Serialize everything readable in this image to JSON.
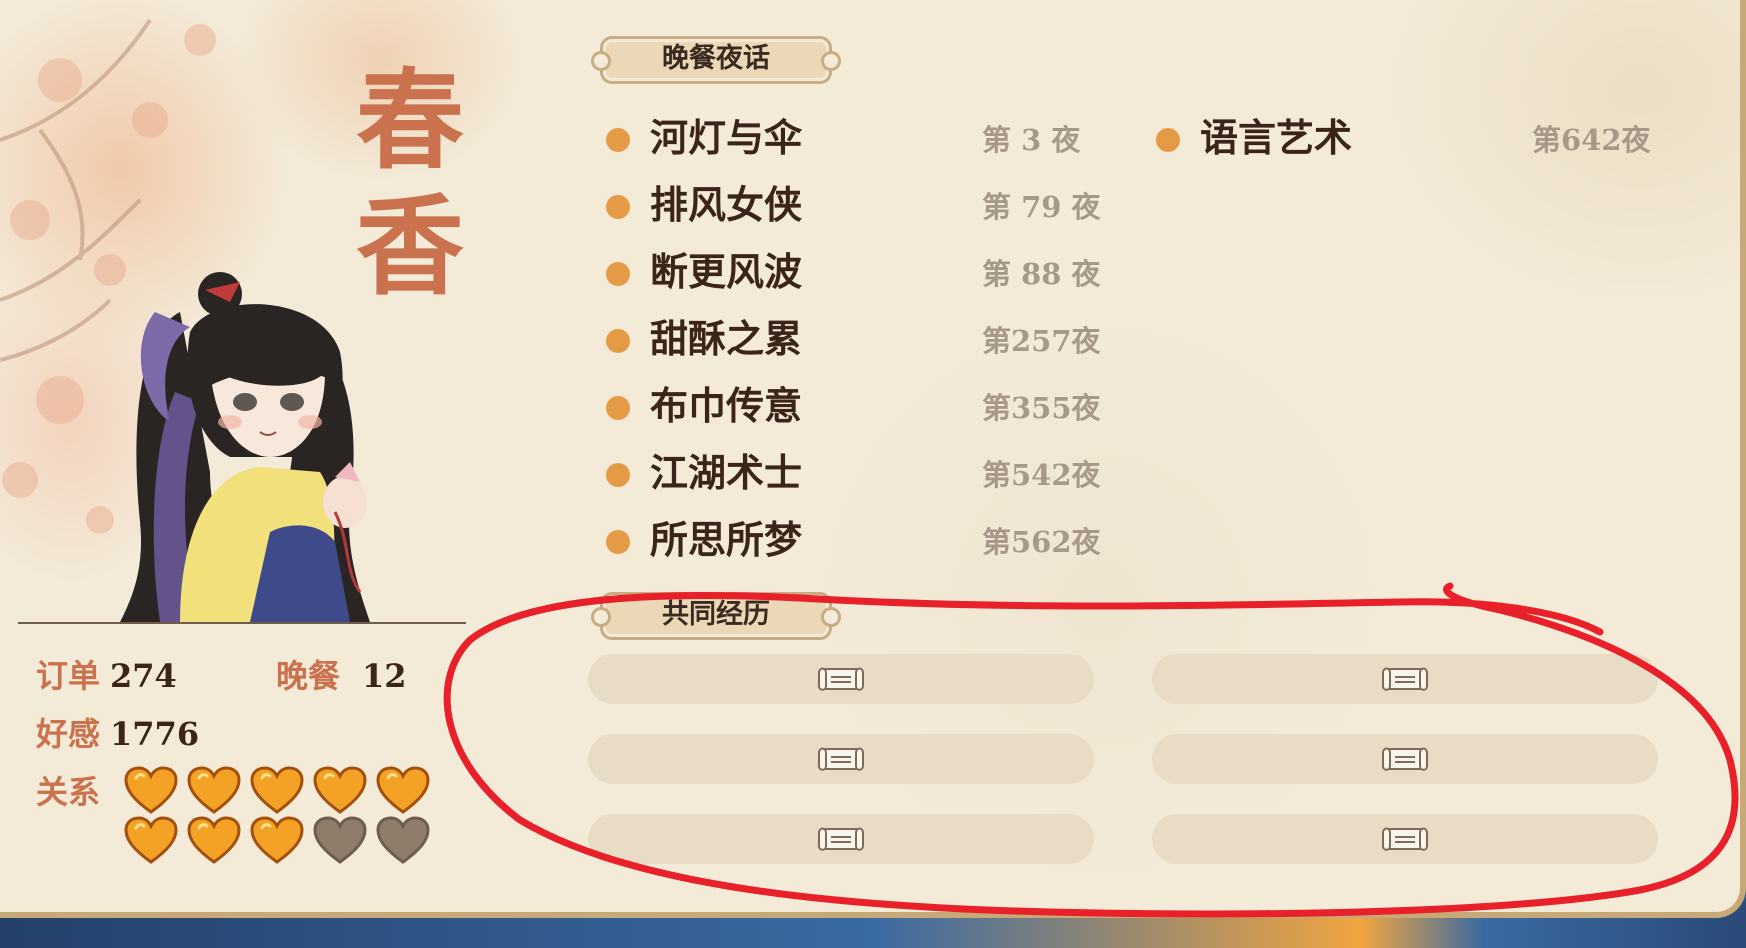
{
  "character": {
    "name_line1": "春",
    "name_line2": "香"
  },
  "sections": {
    "dinner_talks": "晚餐夜话",
    "shared_experience": "共同经历"
  },
  "dinner_events_left": [
    {
      "title": "河灯与伞",
      "night": "第 3 夜"
    },
    {
      "title": "排风女侠",
      "night": "第 79 夜"
    },
    {
      "title": "断更风波",
      "night": "第 88 夜"
    },
    {
      "title": "甜酥之累",
      "night": "第257夜"
    },
    {
      "title": "布巾传意",
      "night": "第355夜"
    },
    {
      "title": "江湖术士",
      "night": "第542夜"
    },
    {
      "title": "所思所梦",
      "night": "第562夜"
    }
  ],
  "dinner_events_right": [
    {
      "title": "语言艺术",
      "night": "第642夜"
    }
  ],
  "stats": {
    "orders_label": "订单",
    "orders_value": "274",
    "dinners_label": "晚餐",
    "dinners_value": "12",
    "affection_label": "好感",
    "affection_value": "1776",
    "relation_label": "关系"
  },
  "relationship": {
    "filled_hearts": 8,
    "total_hearts": 10
  },
  "shared_experience_slots": [
    {
      "icon": "scroll-icon",
      "filled": false
    },
    {
      "icon": "scroll-icon",
      "filled": false
    },
    {
      "icon": "scroll-icon",
      "filled": false
    },
    {
      "icon": "scroll-icon",
      "filled": false
    },
    {
      "icon": "scroll-icon",
      "filled": false
    },
    {
      "icon": "scroll-icon",
      "filled": false
    }
  ],
  "colors": {
    "paper": "#f3ead8",
    "name_accent": "#c9724d",
    "bullet": "#e59b45",
    "heart_full": "#f3a225",
    "heart_empty": "#8f7c6a",
    "annotation": "#e8202a"
  }
}
